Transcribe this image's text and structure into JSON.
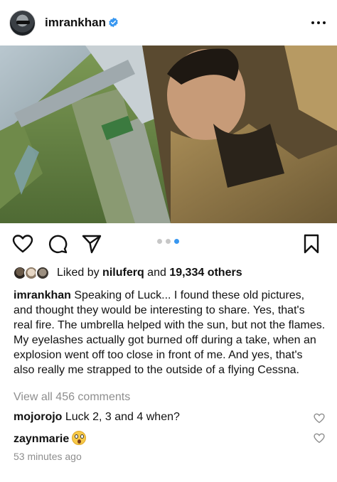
{
  "post": {
    "username": "imrankhan",
    "verified_icon": "verified-badge-icon",
    "more_icon": "more-options-icon"
  },
  "carousel": {
    "total": 3,
    "active_index": 2
  },
  "actions": {
    "like_icon": "heart-icon",
    "comment_icon": "comment-icon",
    "share_icon": "send-icon",
    "save_icon": "bookmark-icon"
  },
  "likes": {
    "prefix": "Liked by ",
    "user": "niluferq",
    "middle": " and ",
    "count": "19,334 others"
  },
  "caption": {
    "username": "imrankhan",
    "text": " Speaking of Luck... I found these old pictures, and thought they would be interesting to share. Yes, that's real fire. The umbrella helped with the sun, but not the flames. My eyelashes actually got burned off during a take, when an explosion went off too close in front of me. And yes, that's also really me strapped to the outside of a flying Cessna."
  },
  "view_all_comments": "View all 456 comments",
  "comments": [
    {
      "username": "mojorojo",
      "text": " Luck 2, 3 and 4 when?"
    },
    {
      "username": "zaynmarie",
      "text": ""
    }
  ],
  "timestamp": "53 minutes ago",
  "colors": {
    "accent_blue": "#3897f0",
    "secondary_text": "#8e8e8e",
    "primary_text": "#111111"
  }
}
